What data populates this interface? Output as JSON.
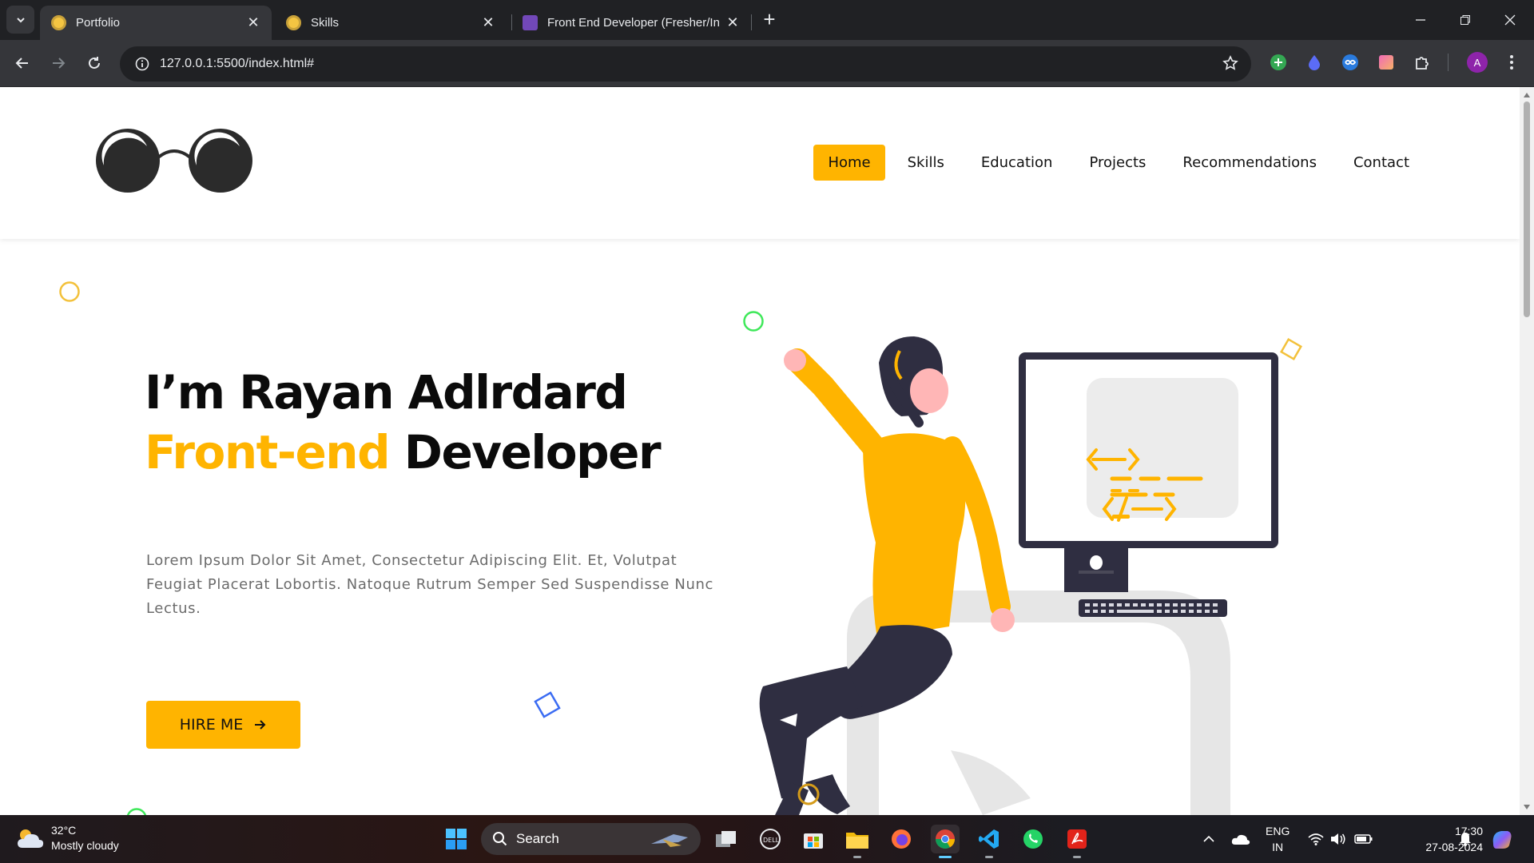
{
  "browser": {
    "tabs": [
      {
        "label": "Portfolio",
        "active": true
      },
      {
        "label": "Skills",
        "active": false
      },
      {
        "label": "Front End Developer (Fresher/In",
        "active": false
      }
    ],
    "url": "127.0.0.1:5500/index.html#",
    "profile_initial": "A",
    "close_glyph": "✕",
    "newtab_glyph": "+"
  },
  "site": {
    "nav": [
      "Home",
      "Skills",
      "Education",
      "Projects",
      "Recommendations",
      "Contact"
    ],
    "active_nav": "Home",
    "hero": {
      "line1": "I’m Rayan Adlrdard",
      "line2_accent": "Front-end",
      "line2_rest": " Developer",
      "description": "Lorem Ipsum Dolor Sit Amet, Consectetur Adipiscing Elit. Et, Volutpat Feugiat Placerat Lobortis. Natoque Rutrum Semper Sed Suspendisse Nunc Lectus.",
      "cta": "HIRE ME"
    },
    "colors": {
      "accent": "#ffb400",
      "dark": "#2f2e41"
    }
  },
  "taskbar": {
    "weather_temp": "32°C",
    "weather_desc": "Mostly cloudy",
    "search_label": "Search",
    "lang_top": "ENG",
    "lang_bottom": "IN",
    "time": "17:30",
    "date": "27-08-2024"
  }
}
